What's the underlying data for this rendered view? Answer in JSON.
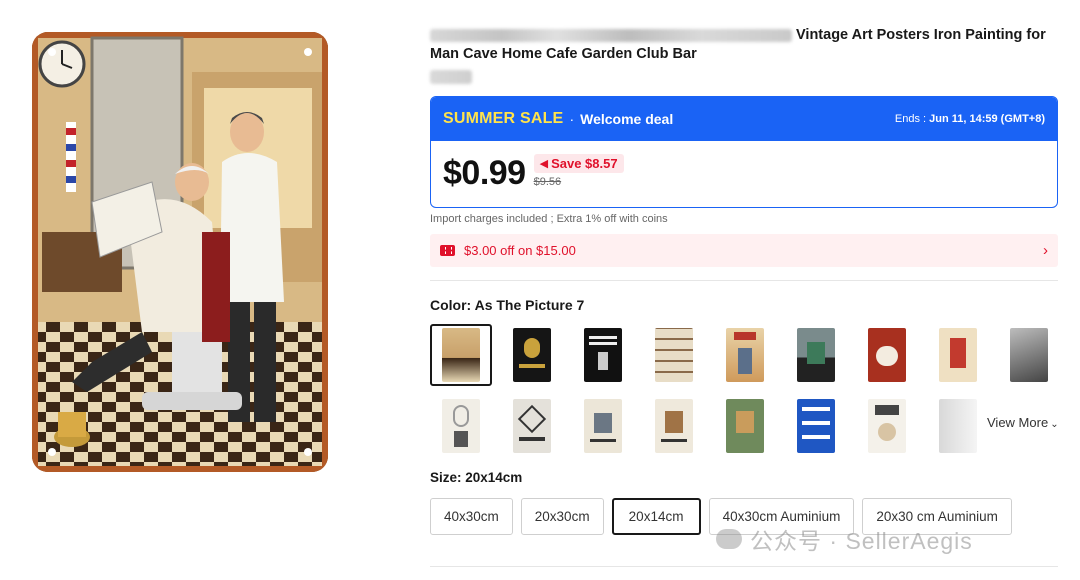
{
  "product": {
    "title": "Vintage Art Posters Iron Painting for Man Cave Home Cafe Garden Club Bar"
  },
  "sale": {
    "tag": "SUMMER SALE",
    "separator": "·",
    "deal_label": "Welcome deal",
    "ends_label": "Ends :",
    "ends_value": "Jun 11, 14:59 (GMT+8)",
    "price": "$0.99",
    "save_label": "Save $8.57",
    "original_price": "$9.56"
  },
  "import_note": "Import charges included ; Extra 1% off with coins",
  "coupon": {
    "text": "$3.00 off on $15.00",
    "arrow": "›"
  },
  "color": {
    "label": "Color: As The Picture 7",
    "view_more": "View More",
    "swatches": [
      {
        "name": "barber-scene",
        "selected": true
      },
      {
        "name": "real-men-dont-shave"
      },
      {
        "name": "these-are-my-weapons"
      },
      {
        "name": "beard-styles"
      },
      {
        "name": "tattoo-barber"
      },
      {
        "name": "barber-shop-checker"
      },
      {
        "name": "dog-groomer"
      },
      {
        "name": "pinup-barber"
      },
      {
        "name": "bw-photo"
      },
      {
        "name": "mirror-chair"
      },
      {
        "name": "barber-shop-scissors"
      },
      {
        "name": "cat-barber-1"
      },
      {
        "name": "cat-barber-2"
      },
      {
        "name": "cat-barber-3"
      },
      {
        "name": "i-will-cut-you"
      },
      {
        "name": "i-cut-hair-dog"
      },
      {
        "name": "tools-faded"
      }
    ]
  },
  "size": {
    "label": "Size: 20x14cm",
    "options": [
      {
        "label": "40x30cm"
      },
      {
        "label": "20x30cm"
      },
      {
        "label": "20x14cm",
        "selected": true
      },
      {
        "label": "40x30cm Auminium"
      },
      {
        "label": "20x30 cm Auminium"
      }
    ]
  },
  "watermark": {
    "text": "公众号 · SellerAegis"
  },
  "colors": {
    "accent_blue": "#1a63f5",
    "sale_yellow": "#ffe34b",
    "red": "#e0112b"
  }
}
